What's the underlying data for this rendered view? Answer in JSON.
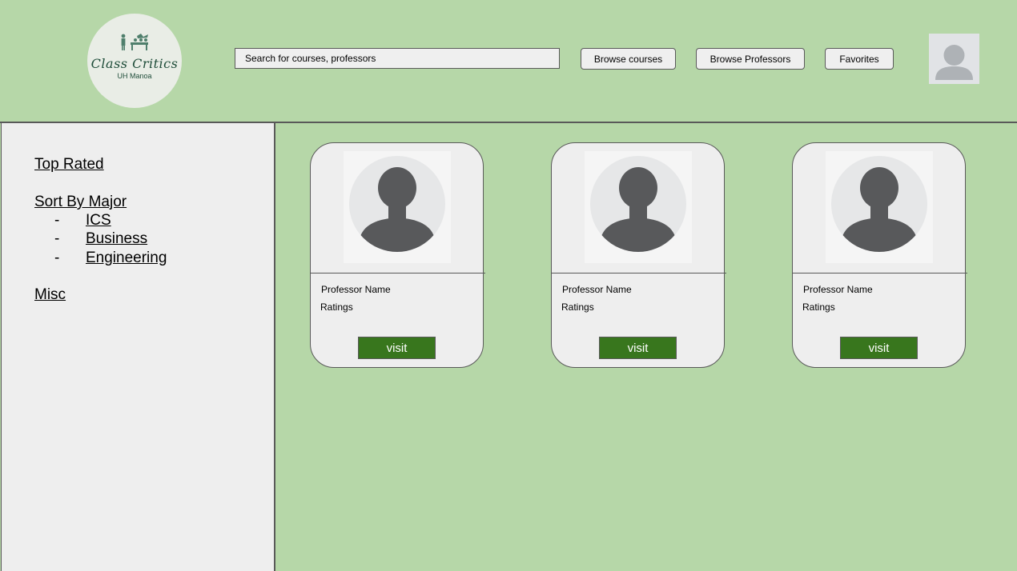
{
  "brand": {
    "name": "Class Critics",
    "subtitle": "UH Manoa"
  },
  "header": {
    "search_placeholder": "Search for courses, professors",
    "browse_courses": "Browse courses",
    "browse_professors": "Browse Professors",
    "favorites": "Favorites"
  },
  "sidebar": {
    "top_rated": "Top Rated",
    "sort_by_major": "Sort By Major",
    "bullet": "-",
    "majors": [
      "ICS",
      "Business",
      "Engineering"
    ],
    "misc": "Misc"
  },
  "cards": [
    {
      "name": "Professor Name",
      "ratings": "Ratings",
      "button": "visit"
    },
    {
      "name": "Professor Name",
      "ratings": "Ratings",
      "button": "visit"
    },
    {
      "name": "Professor Name",
      "ratings": "Ratings",
      "button": "visit"
    }
  ],
  "colors": {
    "background": "#b6d7a8",
    "panel": "#eeeeee",
    "accent": "#38761d",
    "border": "#595959"
  }
}
